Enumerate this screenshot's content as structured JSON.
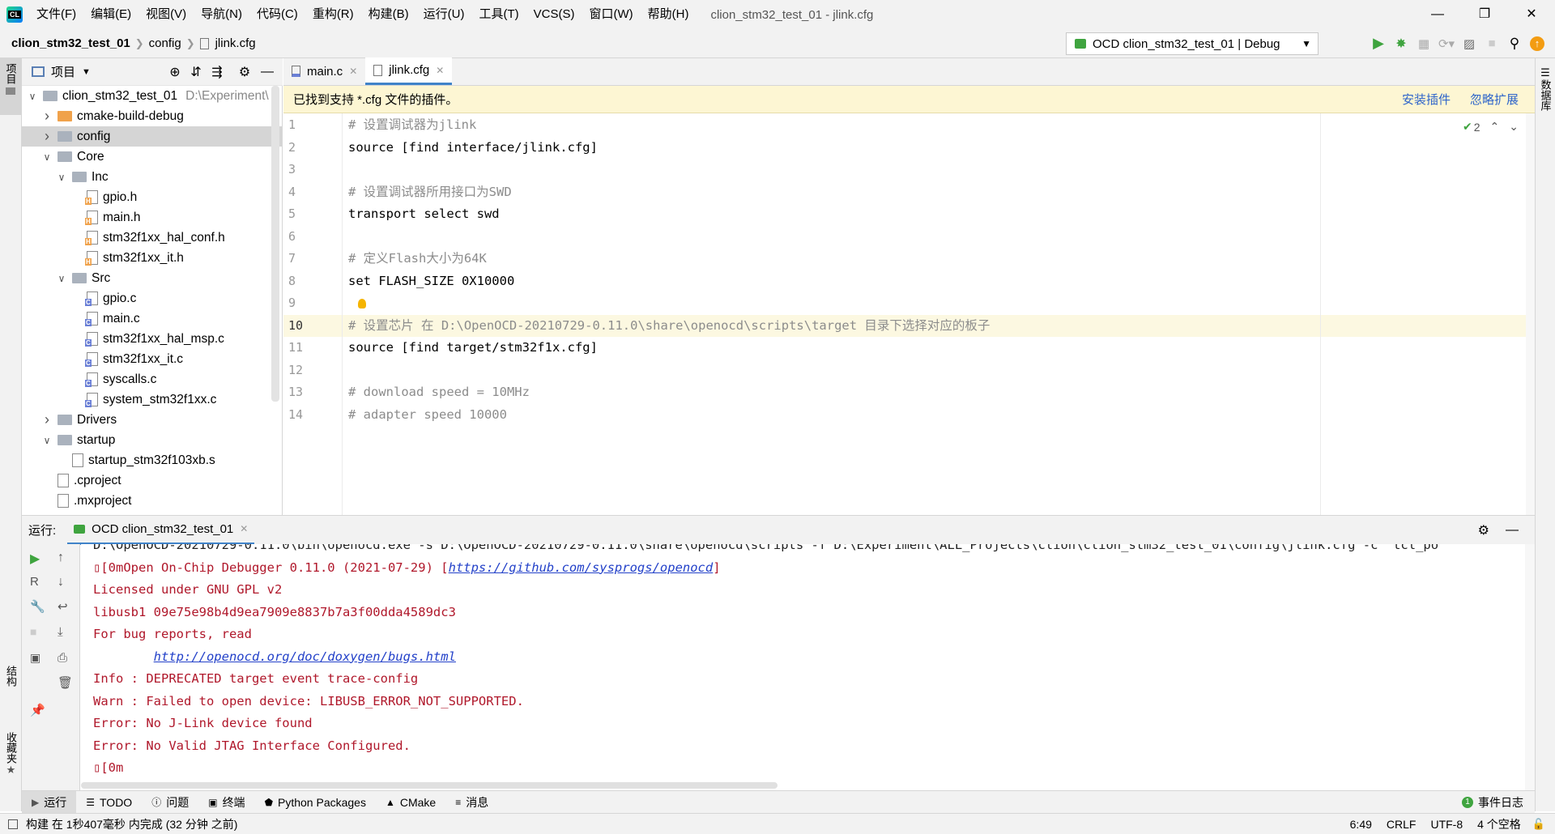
{
  "app": {
    "window_title": "clion_stm32_test_01 - jlink.cfg",
    "menu": [
      "文件(F)",
      "编辑(E)",
      "视图(V)",
      "导航(N)",
      "代码(C)",
      "重构(R)",
      "构建(B)",
      "运行(U)",
      "工具(T)",
      "VCS(S)",
      "窗口(W)",
      "帮助(H)"
    ]
  },
  "breadcrumb": [
    "clion_stm32_test_01",
    "config",
    "jlink.cfg"
  ],
  "run_config": "OCD clion_stm32_test_01 | Debug",
  "left_strip": {
    "project_label": "项目",
    "structure_label": "结构",
    "bookmarks_label": "收藏夹"
  },
  "right_strip": {
    "database_label": "数据库"
  },
  "project": {
    "title": "项目",
    "tree": [
      {
        "name": "clion_stm32_test_01",
        "extra": "D:\\Experiment\\",
        "level": 0,
        "type": "folder",
        "expanded": true
      },
      {
        "name": "cmake-build-debug",
        "level": 1,
        "type": "folder-orange",
        "expanded": false
      },
      {
        "name": "config",
        "level": 1,
        "type": "folder",
        "expanded": false,
        "selected": true
      },
      {
        "name": "Core",
        "level": 1,
        "type": "folder",
        "expanded": true
      },
      {
        "name": "Inc",
        "level": 2,
        "type": "folder",
        "expanded": true
      },
      {
        "name": "gpio.h",
        "level": 3,
        "type": "h"
      },
      {
        "name": "main.h",
        "level": 3,
        "type": "h"
      },
      {
        "name": "stm32f1xx_hal_conf.h",
        "level": 3,
        "type": "h"
      },
      {
        "name": "stm32f1xx_it.h",
        "level": 3,
        "type": "h"
      },
      {
        "name": "Src",
        "level": 2,
        "type": "folder",
        "expanded": true
      },
      {
        "name": "gpio.c",
        "level": 3,
        "type": "c"
      },
      {
        "name": "main.c",
        "level": 3,
        "type": "c"
      },
      {
        "name": "stm32f1xx_hal_msp.c",
        "level": 3,
        "type": "c"
      },
      {
        "name": "stm32f1xx_it.c",
        "level": 3,
        "type": "c"
      },
      {
        "name": "syscalls.c",
        "level": 3,
        "type": "c"
      },
      {
        "name": "system_stm32f1xx.c",
        "level": 3,
        "type": "c"
      },
      {
        "name": "Drivers",
        "level": 1,
        "type": "folder",
        "expanded": false
      },
      {
        "name": "startup",
        "level": 1,
        "type": "folder",
        "expanded": true
      },
      {
        "name": "startup_stm32f103xb.s",
        "level": 2,
        "type": "s"
      },
      {
        "name": ".cproject",
        "level": 1,
        "type": "file"
      },
      {
        "name": ".mxproject",
        "level": 1,
        "type": "file"
      }
    ]
  },
  "tabs": [
    {
      "label": "main.c",
      "active": false
    },
    {
      "label": "jlink.cfg",
      "active": true
    }
  ],
  "banner": {
    "text": "已找到支持 *.cfg 文件的插件。",
    "install": "安装插件",
    "ignore": "忽略扩展"
  },
  "editor": {
    "inspection_count": "2",
    "lines": [
      {
        "n": "1",
        "text": "# 设置调试器为jlink",
        "comment": true
      },
      {
        "n": "2",
        "text": "source [find interface/jlink.cfg]",
        "comment": false
      },
      {
        "n": "3",
        "text": "",
        "comment": false
      },
      {
        "n": "4",
        "text": "# 设置调试器所用接口为SWD",
        "comment": true
      },
      {
        "n": "5",
        "text": "transport select swd",
        "comment": false
      },
      {
        "n": "6",
        "text": "",
        "comment": false
      },
      {
        "n": "7",
        "text": "# 定义Flash大小为64K",
        "comment": true
      },
      {
        "n": "8",
        "text": "set FLASH_SIZE 0X10000",
        "comment": false
      },
      {
        "n": "9",
        "text": "",
        "comment": false
      },
      {
        "n": "10",
        "text": "# 设置芯片 在 D:\\OpenOCD-20210729-0.11.0\\share\\openocd\\scripts\\target 目录下选择对应的板子",
        "comment": true,
        "current": true
      },
      {
        "n": "11",
        "text": "source [find target/stm32f1x.cfg]",
        "comment": false
      },
      {
        "n": "12",
        "text": "",
        "comment": false
      },
      {
        "n": "13",
        "text": "# download speed = 10MHz",
        "comment": true
      },
      {
        "n": "14",
        "text": "# adapter speed 10000",
        "comment": true
      }
    ]
  },
  "run_panel": {
    "label": "运行:",
    "tab": "OCD clion_stm32_test_01",
    "console": [
      {
        "pre": "D:\\OpenOCD-20210729-0.11.0\\bin\\openocd.exe -s D:\\OpenOCD-20210729-0.11.0\\share\\openocd\\scripts -f D:\\Experiment\\ALL_Projects\\clion\\clion_stm32_test_01\\config\\jlink.cfg -c \"tcl_po",
        "link": "",
        "post": ""
      },
      {
        "pre": "▯[0mOpen On-Chip Debugger 0.11.0 (2021-07-29) [",
        "link": "https://github.com/sysprogs/openocd",
        "post": "]"
      },
      {
        "pre": "Licensed under GNU GPL v2",
        "link": "",
        "post": ""
      },
      {
        "pre": "libusb1 09e75e98b4d9ea7909e8837b7a3f00dda4589dc3",
        "link": "",
        "post": ""
      },
      {
        "pre": "For bug reports, read",
        "link": "",
        "post": ""
      },
      {
        "pre": "        ",
        "link": "http://openocd.org/doc/doxygen/bugs.html",
        "post": ""
      },
      {
        "pre": "Info : DEPRECATED target event trace-config",
        "link": "",
        "post": ""
      },
      {
        "pre": "Warn : Failed to open device: LIBUSB_ERROR_NOT_SUPPORTED.",
        "link": "",
        "post": ""
      },
      {
        "pre": "Error: No J-Link device found",
        "link": "",
        "post": ""
      },
      {
        "pre": "Error: No Valid JTAG Interface Configured.",
        "link": "",
        "post": ""
      },
      {
        "pre": "▯[0m",
        "link": "",
        "post": ""
      }
    ]
  },
  "bottom_tabs": [
    "运行",
    "TODO",
    "问题",
    "终端",
    "Python Packages",
    "CMake",
    "消息"
  ],
  "event_log": "事件日志",
  "status": {
    "message": "构建 在 1秒407毫秒 内完成 (32 分钟 之前)",
    "position": "6:49",
    "line_ending": "CRLF",
    "encoding": "UTF-8",
    "indent": "4 个空格"
  },
  "colors": {
    "accent": "#4083c9",
    "comment": "#8c8c8c",
    "console_error": "#b0182b",
    "link": "#2341c9",
    "banner_bg": "#fdf6d3",
    "current_line": "#fcf8e1"
  }
}
